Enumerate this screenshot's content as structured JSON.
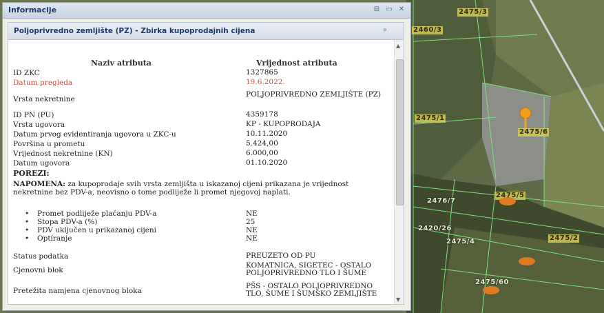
{
  "panel": {
    "title": "Informacije",
    "tools": [
      "⊟",
      "▭",
      "✕"
    ]
  },
  "subpanel": {
    "title": "Poljoprivredno zemljište (PZ) - Zbirka kupoprodajnih cijena",
    "collapse": "»"
  },
  "table": {
    "col_name": "Naziv atributa",
    "col_value": "Vrijednost atributa",
    "rows": [
      {
        "name": "ID ZKC",
        "value": "1327865"
      },
      {
        "name": "Datum pregleda",
        "value": "19.6.2022."
      },
      {
        "name": "Vrsta nekretnine",
        "value": "POLJOPRIVREDNO ZEMLJIŠTE (PZ)"
      },
      {
        "name": "ID PN (PU)",
        "value": "4359178"
      },
      {
        "name": "Vrsta ugovora",
        "value": "KP - KUPOPRODAJA"
      },
      {
        "name": "Datum prvog evidentiranja ugovora u ZKC-u",
        "value": "10.11.2020"
      },
      {
        "name": "Površina u prometu",
        "value": "5.424,00"
      },
      {
        "name": "Vrijednost nekretnine (KN)",
        "value": "6.000,00"
      },
      {
        "name": "Datum ugovora",
        "value": "01.10.2020"
      }
    ]
  },
  "taxes": {
    "heading": "POREZI:",
    "note_label": "NAPOMENA:",
    "note_text": " za kupoprodaje svih vrsta zemljišta u iskazanoj cijeni prikazana je vrijednost nekretnine bez PDV-a, neovisno o tome podliježe li promet njegovoj naplati.",
    "items": [
      {
        "name": "Promet podliježe plaćanju PDV-a",
        "value": "NE"
      },
      {
        "name": "Stopa PDV-a (%)",
        "value": "25"
      },
      {
        "name": "PDV uključen u prikazanoj cijeni",
        "value": "NE"
      },
      {
        "name": "Optíranje",
        "value": "NE"
      }
    ]
  },
  "extra": [
    {
      "name": "Status podatka",
      "value": "PREUZETO OD PU"
    },
    {
      "name": "Cjenovni blok",
      "value": "KOMATNICA, SIGETEC - OSTALO POLJOPRIVREDNO TLO I ŠUME"
    },
    {
      "name": "Pretežita namjena cjenovnog bloka",
      "value": "PŠS - OSTALO POLJOPRIVREDNO TLO, ŠUME I ŠUMSKO ZEMLJIŠTE"
    }
  ],
  "map": {
    "labels": [
      "2475/3",
      "2460/3",
      "2475/1",
      "2475/6",
      "2420/26",
      "2475/4",
      "2475/5",
      "2475/2",
      "2475/60",
      "2476/7"
    ]
  }
}
